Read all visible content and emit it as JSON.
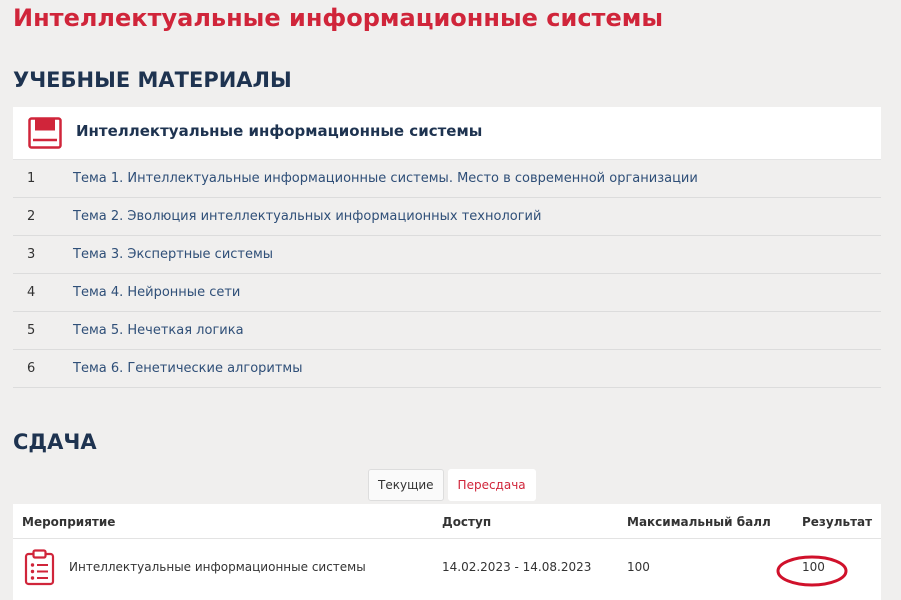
{
  "page": {
    "title": "Интеллектуальные информационные системы"
  },
  "materials": {
    "heading": "УЧЕБНЫЕ МАТЕРИАЛЫ",
    "course_title": "Интеллектуальные информационные системы",
    "topics": [
      {
        "num": "1",
        "label": "Тема 1. Интеллектуальные информационные системы. Место в современной организации"
      },
      {
        "num": "2",
        "label": "Тема 2. Эволюция интеллектуальных информационных технологий"
      },
      {
        "num": "3",
        "label": "Тема 3. Экспертные системы"
      },
      {
        "num": "4",
        "label": "Тема 4. Нейронные сети"
      },
      {
        "num": "5",
        "label": "Тема 5. Нечеткая логика"
      },
      {
        "num": "6",
        "label": "Тема 6. Генетические алгоритмы"
      }
    ]
  },
  "exam": {
    "heading": "СДАЧА",
    "tabs": {
      "current": "Текущие",
      "retake": "Пересдача"
    },
    "columns": {
      "event": "Мероприятие",
      "access": "Доступ",
      "max_score": "Максимальный балл",
      "result": "Результат"
    },
    "rows": [
      {
        "event": "Интеллектуальные информационные системы",
        "access": "14.02.2023 - 14.08.2023",
        "max_score": "100",
        "result": "100"
      }
    ]
  },
  "colors": {
    "accent": "#d0253a",
    "heading": "#1e3350",
    "link": "#2f4f78",
    "background": "#f0efee"
  },
  "icons": {
    "course": "book-icon",
    "exam": "clipboard-list-icon",
    "highlight": "red-circle-annotation"
  }
}
